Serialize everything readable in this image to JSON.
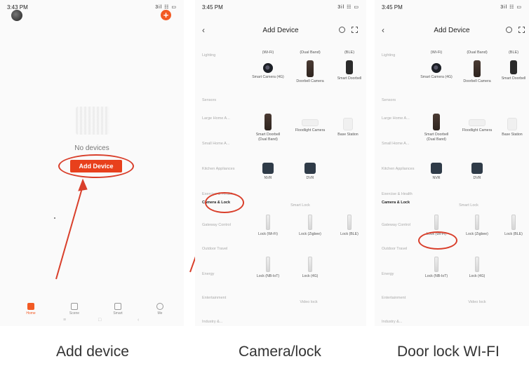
{
  "screens": [
    {
      "status_time": "3:43 PM",
      "status_icons": "3il ☷ ▭",
      "no_devices": "No devices",
      "add_device_button": "Add Device",
      "tabs": [
        "Home",
        "Scene",
        "Smart",
        "Me"
      ]
    },
    {
      "status_time": "3:45 PM",
      "status_icons": "3il ☷ ▭",
      "title": "Add Device"
    },
    {
      "status_time": "3:45 PM",
      "status_icons": "3il ☷ ▭",
      "title": "Add Device"
    }
  ],
  "categories": [
    "Lighting",
    "Sensors",
    "Large Home A...",
    "Small Home A...",
    "Kitchen Appliances",
    "Exercise & Health",
    "Camera & Lock",
    "Gateway Control",
    "Outdoor Travel",
    "Energy",
    "Entertainment",
    "Industry &..."
  ],
  "column_headers": [
    "(Wi-Fi)",
    "(Dual Band)",
    "(BLE)"
  ],
  "devices": [
    "Smart Camera (4G)",
    "Doorbell Camera",
    "Smart Doorbell",
    "Smart Doorbell (Dual Band)",
    "Floodlight Camera",
    "Base Station",
    "NVR",
    "DVR"
  ],
  "smart_lock_section": "Smart Lock",
  "video_lock_section": "Video lock",
  "locks": [
    "Lock (Wi-Fi)",
    "Lock (Zigbee)",
    "Lock (BLE)",
    "Lock (NB-IoT)",
    "Lock (4G)"
  ],
  "captions": [
    "Add device",
    "Camera/lock",
    "Door lock WI-FI"
  ],
  "colors": {
    "accent": "#f25a24",
    "annotation": "#d93f2b"
  }
}
